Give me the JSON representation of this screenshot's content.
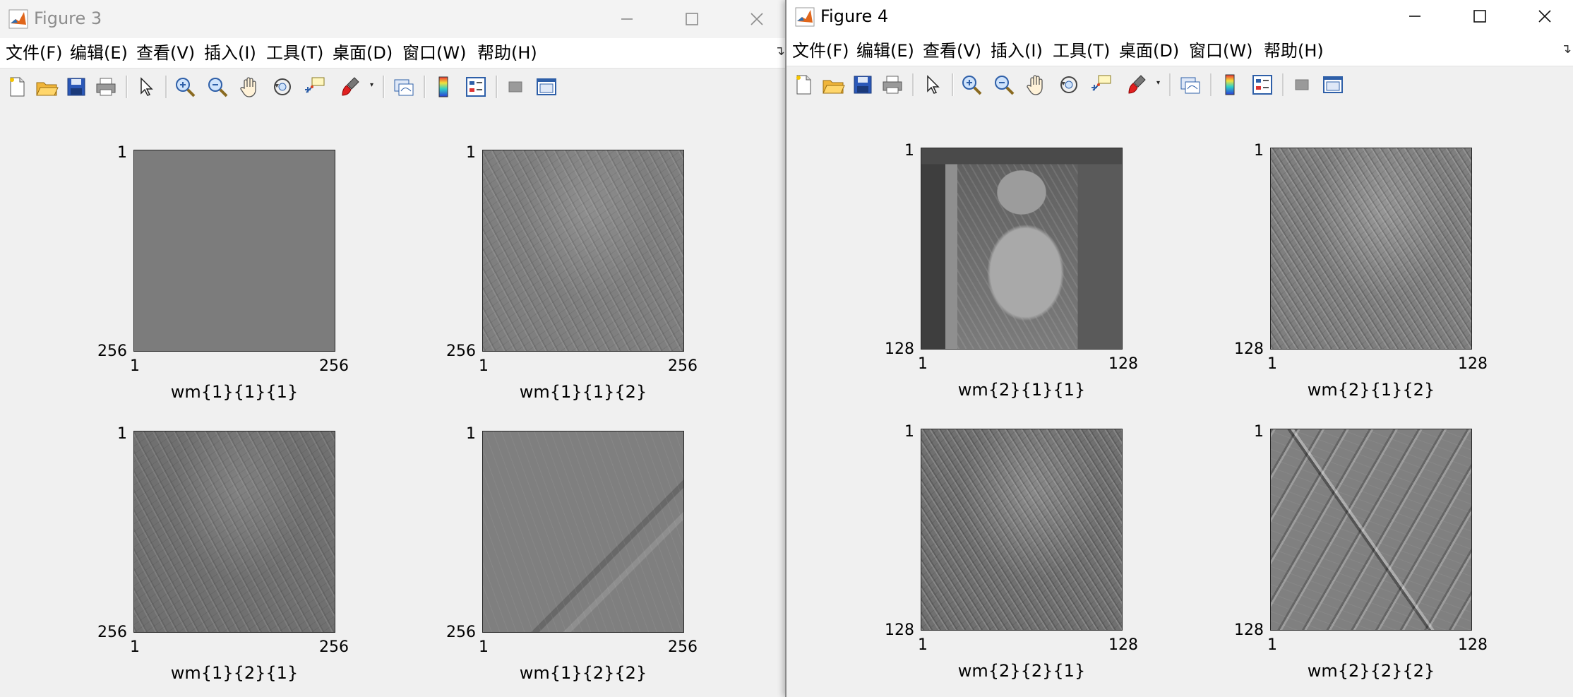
{
  "menu_labels": [
    "文件(F)",
    "编辑(E)",
    "查看(V)",
    "插入(I)",
    "工具(T)",
    "桌面(D)",
    "窗口(W)",
    "帮助(H)"
  ],
  "toolbar_icons": [
    "new-figure-icon",
    "open-file-icon",
    "save-icon",
    "print-icon",
    "edit-plot-pointer-icon",
    "zoom-in-icon",
    "zoom-out-icon",
    "pan-hand-icon",
    "rotate-3d-icon",
    "data-cursor-icon",
    "brush-icon",
    "link-plot-icon",
    "colorbar-icon",
    "legend-icon",
    "hide-plot-tools-icon",
    "show-plot-tools-icon"
  ],
  "colors": {
    "titlebar_active": "#ffffff",
    "titlebar_inactive": "#f3f3f3",
    "canvas": "#f0f0f0",
    "axes_border": "#262626"
  },
  "windows": [
    {
      "title": "Figure 3",
      "active": false,
      "subplots": [
        {
          "label": "wm{1}{1}{1}",
          "x_ticks": [
            "1",
            "256"
          ],
          "y_ticks": [
            "1",
            "256"
          ],
          "content": "uniform-gray"
        },
        {
          "label": "wm{1}{1}{2}",
          "x_ticks": [
            "1",
            "256"
          ],
          "y_ticks": [
            "1",
            "256"
          ],
          "content": "edge-detail"
        },
        {
          "label": "wm{1}{2}{1}",
          "x_ticks": [
            "1",
            "256"
          ],
          "y_ticks": [
            "1",
            "256"
          ],
          "content": "edge-detail"
        },
        {
          "label": "wm{1}{2}{2}",
          "x_ticks": [
            "1",
            "256"
          ],
          "y_ticks": [
            "1",
            "256"
          ],
          "content": "edge-detail"
        }
      ]
    },
    {
      "title": "Figure 4",
      "active": true,
      "subplots": [
        {
          "label": "wm{2}{1}{1}",
          "x_ticks": [
            "1",
            "128"
          ],
          "y_ticks": [
            "1",
            "128"
          ],
          "content": "grayscale-photo"
        },
        {
          "label": "wm{2}{1}{2}",
          "x_ticks": [
            "1",
            "128"
          ],
          "y_ticks": [
            "1",
            "128"
          ],
          "content": "edge-detail"
        },
        {
          "label": "wm{2}{2}{1}",
          "x_ticks": [
            "1",
            "128"
          ],
          "y_ticks": [
            "1",
            "128"
          ],
          "content": "edge-detail"
        },
        {
          "label": "wm{2}{2}{2}",
          "x_ticks": [
            "1",
            "128"
          ],
          "y_ticks": [
            "1",
            "128"
          ],
          "content": "edge-detail"
        }
      ]
    }
  ]
}
